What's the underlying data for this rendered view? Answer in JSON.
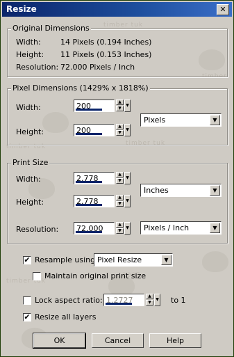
{
  "window": {
    "title": "Resize",
    "close_glyph": "✕"
  },
  "watermark": {
    "text1": "timber",
    "text2": "tuk",
    "text3": "2007"
  },
  "original": {
    "group_title": "Original Dimensions",
    "width_label": "Width:",
    "width_value": "14 Pixels (0.194 Inches)",
    "height_label": "Height:",
    "height_value": "11 Pixels (0.153 Inches)",
    "resolution_label": "Resolution:",
    "resolution_value": "72.000 Pixels / Inch"
  },
  "pixel_dimensions": {
    "group_title": "Pixel Dimensions (1429% x 1818%)",
    "width_label": "Width:",
    "width_value": "200",
    "height_label": "Height:",
    "height_value": "200",
    "unit": "Pixels"
  },
  "print_size": {
    "group_title": "Print Size",
    "width_label": "Width:",
    "width_value": "2.778",
    "height_label": "Height:",
    "height_value": "2.778",
    "unit": "Inches",
    "resolution_label": "Resolution:",
    "resolution_value": "72.000",
    "resolution_unit": "Pixels / Inch"
  },
  "options": {
    "resample_label": "Resample using:",
    "resample_checked": true,
    "resample_method": "Pixel Resize",
    "maintain_label": "Maintain original print size",
    "maintain_checked": false,
    "lock_label": "Lock aspect ratio:",
    "lock_checked": false,
    "ratio_value": "1.2727",
    "ratio_suffix": "to 1",
    "resize_layers_label": "Resize all layers",
    "resize_layers_checked": true
  },
  "buttons": {
    "ok": "OK",
    "cancel": "Cancel",
    "help": "Help"
  },
  "glyphs": {
    "check": "✔",
    "up": "▲",
    "down": "▼"
  }
}
